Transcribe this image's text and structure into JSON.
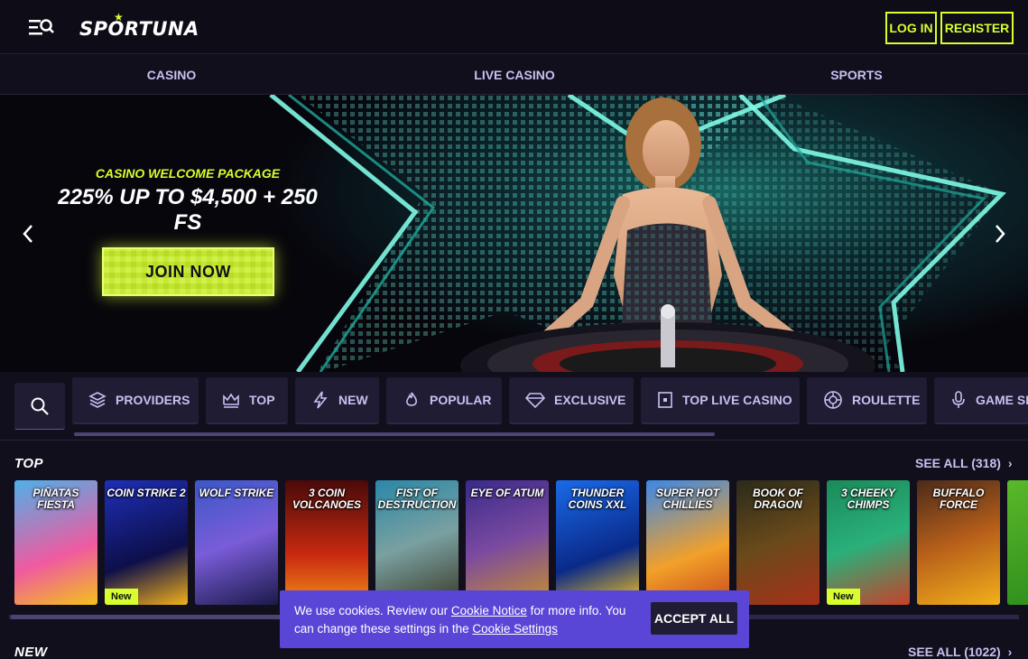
{
  "header": {
    "logo_text": "SPORTUNA",
    "login_label": "LOG IN",
    "register_label": "REGISTER"
  },
  "nav": {
    "items": [
      {
        "label": "CASINO"
      },
      {
        "label": "LIVE CASINO"
      },
      {
        "label": "SPORTS"
      }
    ]
  },
  "hero": {
    "kicker": "CASINO WELCOME PACKAGE",
    "title_line1": "225% UP TO $4,500 + 250",
    "title_line2": "FS",
    "cta_label": "JOIN NOW"
  },
  "categories": {
    "items": [
      {
        "label": "PROVIDERS",
        "icon": "layers-icon"
      },
      {
        "label": "TOP",
        "icon": "crown-icon"
      },
      {
        "label": "NEW",
        "icon": "lightning-icon"
      },
      {
        "label": "POPULAR",
        "icon": "flame-icon"
      },
      {
        "label": "EXCLUSIVE",
        "icon": "diamond-icon"
      },
      {
        "label": "TOP LIVE CASINO",
        "icon": "card-icon"
      },
      {
        "label": "ROULETTE",
        "icon": "roulette-icon"
      },
      {
        "label": "GAME SH",
        "icon": "microphone-icon"
      }
    ]
  },
  "top_section": {
    "title": "TOP",
    "see_all": "SEE ALL (318)",
    "games": [
      {
        "title": "PIÑATAS FIESTA",
        "badge": ""
      },
      {
        "title": "COIN STRIKE 2",
        "badge": "New"
      },
      {
        "title": "WOLF STRIKE",
        "badge": ""
      },
      {
        "title": "3 COIN VOLCANOES",
        "badge": ""
      },
      {
        "title": "FIST OF DESTRUCTION",
        "badge": ""
      },
      {
        "title": "EYE OF ATUM",
        "badge": ""
      },
      {
        "title": "THUNDER COINS XXL",
        "badge": ""
      },
      {
        "title": "SUPER HOT CHILLIES",
        "badge": ""
      },
      {
        "title": "BOOK OF DRAGON",
        "badge": ""
      },
      {
        "title": "3 CHEEKY CHIMPS",
        "badge": "New"
      },
      {
        "title": "BUFFALO FORCE",
        "badge": ""
      },
      {
        "title": "",
        "badge": ""
      }
    ]
  },
  "new_section": {
    "title": "NEW",
    "see_all": "SEE ALL (1022)"
  },
  "cookie": {
    "text_before": "We use cookies. Review our ",
    "link1": "Cookie Notice",
    "text_middle": " for more info. You can change these settings in the ",
    "link2": "Cookie Settings",
    "accept_label": "ACCEPT ALL"
  },
  "colors": {
    "accent": "#d7ff2f",
    "background": "#120f1d",
    "nav_text": "#c8c0f0",
    "cookie_bg": "#5a46d6"
  }
}
